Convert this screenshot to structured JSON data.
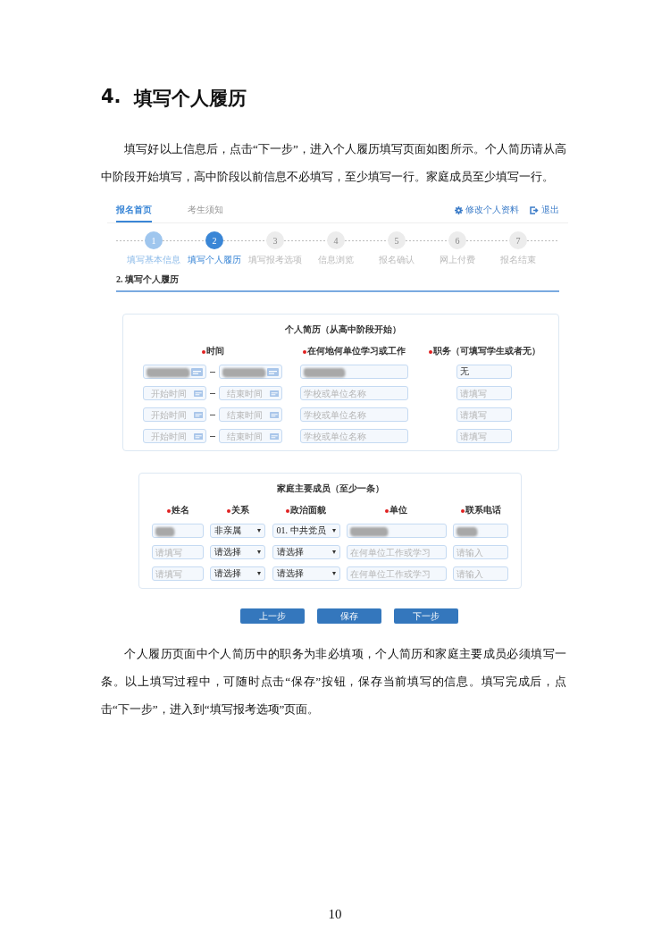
{
  "document": {
    "heading_number": "4.",
    "heading": "填写个人履历",
    "intro": "填写好以上信息后，点击“下一步”，进入个人履历填写页面如图所示。个人简历请从高中阶段开始填写，高中阶段以前信息不必填写，至少填写一行。家庭成员至少填写一行。",
    "note": "个人履历页面中个人简历中的职务为非必填项，个人简历和家庭主要成员必须填写一条。以上填写过程中，可随时点击“保存”按钮，保存当前填写的信息。填写完成后，点击“下一步”，进入到“填写报考选项”页面。",
    "page_number": "10"
  },
  "app": {
    "tabs": [
      {
        "label": "报名首页",
        "selected": true
      },
      {
        "label": "考生须知",
        "selected": false
      }
    ],
    "links": [
      {
        "label": "修改个人资料",
        "kind": "settings"
      },
      {
        "label": "退出",
        "kind": "logout"
      }
    ],
    "steps": [
      {
        "number": "1",
        "label": "填写基本信息",
        "done": true,
        "selected": false
      },
      {
        "number": "2",
        "label": "填写个人履历",
        "done": false,
        "selected": true
      },
      {
        "number": "3",
        "label": "填写报考选项",
        "done": false,
        "selected": false
      },
      {
        "number": "4",
        "label": "信息浏览",
        "done": false,
        "selected": false
      },
      {
        "number": "5",
        "label": "报名确认",
        "done": false,
        "selected": false
      },
      {
        "number": "6",
        "label": "网上付费",
        "done": false,
        "selected": false
      },
      {
        "number": "7",
        "label": "报名结束",
        "done": false,
        "selected": false
      }
    ],
    "section_title": "2. 填写个人履历",
    "resume": {
      "title": "个人简历（从高中阶段开始）",
      "columns": [
        {
          "label": "时间",
          "required": true
        },
        {
          "label": "在何地何单位学习或工作",
          "required": true
        },
        {
          "label": "职务（可填写学生或者无）",
          "required": true
        }
      ],
      "rows": [
        {
          "start": {
            "kind": "date",
            "redacted": true
          },
          "end": {
            "kind": "date",
            "redacted": true
          },
          "unit": {
            "kind": "text",
            "redacted": true
          },
          "role": {
            "kind": "text",
            "value": "无"
          }
        },
        {
          "start": {
            "kind": "date",
            "placeholder": "开始时间"
          },
          "end": {
            "kind": "date",
            "placeholder": "结束时间"
          },
          "unit": {
            "kind": "text",
            "placeholder": "学校或单位名称"
          },
          "role": {
            "kind": "text",
            "placeholder": "请填写"
          }
        },
        {
          "start": {
            "kind": "date",
            "placeholder": "开始时间"
          },
          "end": {
            "kind": "date",
            "placeholder": "结束时间"
          },
          "unit": {
            "kind": "text",
            "placeholder": "学校或单位名称"
          },
          "role": {
            "kind": "text",
            "placeholder": "请填写"
          }
        },
        {
          "start": {
            "kind": "date",
            "placeholder": "开始时间"
          },
          "end": {
            "kind": "date",
            "placeholder": "结束时间"
          },
          "unit": {
            "kind": "text",
            "placeholder": "学校或单位名称"
          },
          "role": {
            "kind": "text",
            "placeholder": "请填写"
          }
        }
      ]
    },
    "family": {
      "title": "家庭主要成员（至少一条）",
      "columns": [
        {
          "label": "姓名",
          "required": true
        },
        {
          "label": "关系",
          "required": true
        },
        {
          "label": "政治面貌",
          "required": true
        },
        {
          "label": "单位",
          "required": true
        },
        {
          "label": "联系电话",
          "required": true
        }
      ],
      "rows": [
        [
          {
            "kind": "text",
            "redacted": true
          },
          {
            "kind": "select",
            "value": "非亲属"
          },
          {
            "kind": "select",
            "value": "01. 中共党员"
          },
          {
            "kind": "text",
            "redacted": true
          },
          {
            "kind": "text",
            "redacted": true
          }
        ],
        [
          {
            "kind": "text",
            "placeholder": "请填写"
          },
          {
            "kind": "select",
            "value": "请选择"
          },
          {
            "kind": "select",
            "value": "请选择"
          },
          {
            "kind": "text",
            "placeholder": "在何单位工作或学习"
          },
          {
            "kind": "text",
            "placeholder": "请输入"
          }
        ],
        [
          {
            "kind": "text",
            "placeholder": "请填写"
          },
          {
            "kind": "select",
            "value": "请选择"
          },
          {
            "kind": "select",
            "value": "请选择"
          },
          {
            "kind": "text",
            "placeholder": "在何单位工作或学习"
          },
          {
            "kind": "text",
            "placeholder": "请输入"
          }
        ]
      ]
    },
    "buttons": [
      "上一步",
      "保存",
      "下一步"
    ]
  }
}
